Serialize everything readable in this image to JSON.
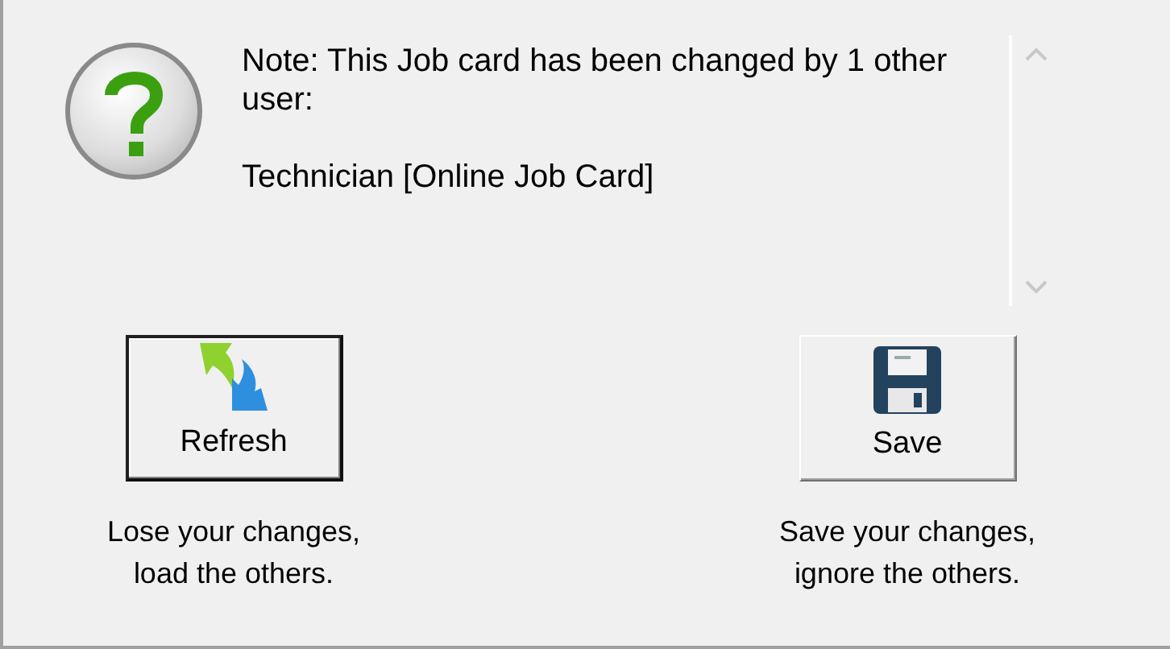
{
  "message": {
    "paragraphs": [
      "Note: This Job card has been changed by 1 other user:",
      "Technician [Online Job Card]"
    ]
  },
  "actions": [
    {
      "kind": "refresh",
      "label": "Refresh",
      "default": true,
      "caption": "Lose your changes,\nload the others."
    },
    {
      "kind": "save",
      "label": "Save",
      "default": false,
      "caption": "Save your changes,\nignore the others."
    }
  ]
}
